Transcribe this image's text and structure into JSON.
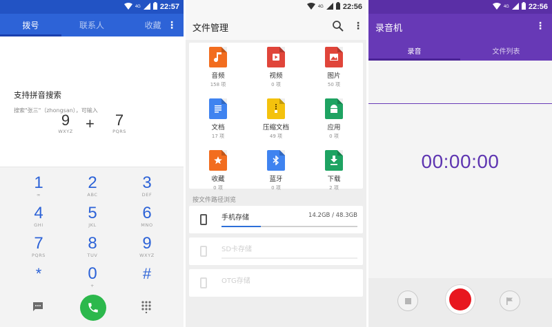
{
  "status_bars": [
    {
      "network": "4G",
      "time": "22:57"
    },
    {
      "network": "4G",
      "time": "22:56"
    },
    {
      "network": "4G",
      "time": "22:56"
    }
  ],
  "dialer": {
    "tabs": [
      {
        "label": "拨号",
        "active": true
      },
      {
        "label": "联系人",
        "active": false
      },
      {
        "label": "收藏",
        "active": false
      }
    ],
    "pinyin_title": "支持拼音搜索",
    "pinyin_hint": "搜索\"张三\"（zhongsan），可输入",
    "example": {
      "left_digit": "9",
      "left_letters": "WXYZ",
      "plus": "+",
      "right_digit": "7",
      "right_letters": "PQRS"
    },
    "keys": [
      {
        "digit": "1",
        "letters": "∞"
      },
      {
        "digit": "2",
        "letters": "ABC"
      },
      {
        "digit": "3",
        "letters": "DEF"
      },
      {
        "digit": "4",
        "letters": "GHI"
      },
      {
        "digit": "5",
        "letters": "JKL"
      },
      {
        "digit": "6",
        "letters": "MNO"
      },
      {
        "digit": "7",
        "letters": "PQRS"
      },
      {
        "digit": "8",
        "letters": "TUV"
      },
      {
        "digit": "9",
        "letters": "WXYZ"
      },
      {
        "digit": "*",
        "letters": ""
      },
      {
        "digit": "0",
        "letters": "+"
      },
      {
        "digit": "#",
        "letters": ""
      }
    ],
    "accent": "#2d63d7",
    "call_color": "#2cb84c"
  },
  "file_manager": {
    "title": "文件管理",
    "categories": [
      {
        "label": "音频",
        "count": "158 项",
        "color": "#f26d1f",
        "icon": "music-note-icon"
      },
      {
        "label": "视频",
        "count": "0 项",
        "color": "#e0453a",
        "icon": "video-icon"
      },
      {
        "label": "图片",
        "count": "50 项",
        "color": "#e0453a",
        "icon": "image-icon"
      },
      {
        "label": "文档",
        "count": "17 项",
        "color": "#3f83f0",
        "icon": "document-icon"
      },
      {
        "label": "压缩文档",
        "count": "49 项",
        "color": "#f4c20d",
        "icon": "archive-icon"
      },
      {
        "label": "应用",
        "count": "0 项",
        "color": "#1ea362",
        "icon": "android-icon"
      },
      {
        "label": "收藏",
        "count": "0 项",
        "color": "#f26d1f",
        "icon": "star-icon"
      },
      {
        "label": "蓝牙",
        "count": "0 项",
        "color": "#3f83f0",
        "icon": "bluetooth-icon"
      },
      {
        "label": "下载",
        "count": "2 项",
        "color": "#1ea362",
        "icon": "download-icon"
      }
    ],
    "browse_label": "按文件路径浏览",
    "storages": [
      {
        "name": "手机存储",
        "size": "14.2GB / 48.3GB",
        "used_fraction": 0.29,
        "enabled": true
      },
      {
        "name": "SD卡存储",
        "size": "",
        "enabled": false
      },
      {
        "name": "OTG存储",
        "size": "",
        "enabled": false
      }
    ]
  },
  "recorder": {
    "title": "录音机",
    "tabs": [
      {
        "label": "录音",
        "active": true
      },
      {
        "label": "文件列表",
        "active": false
      }
    ],
    "timer": "00:00:00",
    "accent": "#6739b6",
    "record_color": "#e8171f"
  }
}
